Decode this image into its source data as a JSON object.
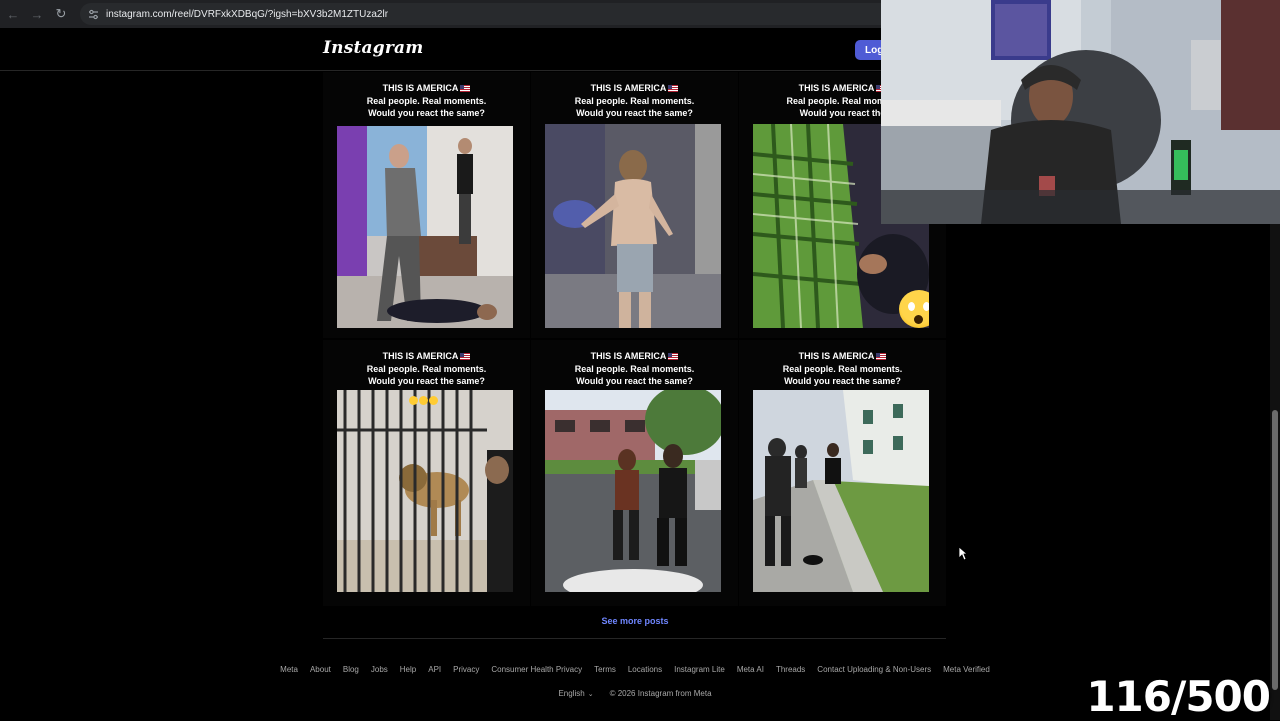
{
  "browser": {
    "url": "instagram.com/reel/DVRFxkXDBqG/?igsh=bXV3b2M1ZTUza2lr"
  },
  "header": {
    "logo_text": "Instagram",
    "login_label": "Log"
  },
  "posts": [
    {
      "line1": "THIS IS AMERICA",
      "line2": "Real people. Real moments.",
      "line3": "Would you react the same?"
    },
    {
      "line1": "THIS IS AMERICA",
      "line2": "Real people. Real moments.",
      "line3": "Would you react the same?"
    },
    {
      "line1": "THIS IS AMERICA",
      "line2": "Real people. Real moment",
      "line3": "Would you react the"
    },
    {
      "line1": "THIS IS AMERICA",
      "line2": "Real people. Real moments.",
      "line3": "Would you react the same?"
    },
    {
      "line1": "THIS IS AMERICA",
      "line2": "Real people. Real moments.",
      "line3": "Would you react the same?"
    },
    {
      "line1": "THIS IS AMERICA",
      "line2": "Real people. Real moments.",
      "line3": "Would you react the same?"
    }
  ],
  "see_more_label": "See more posts",
  "footer": {
    "links": [
      "Meta",
      "About",
      "Blog",
      "Jobs",
      "Help",
      "API",
      "Privacy",
      "Consumer Health Privacy",
      "Terms",
      "Locations",
      "Instagram Lite",
      "Meta AI",
      "Threads",
      "Contact Uploading & Non-Users",
      "Meta Verified"
    ],
    "language": "English",
    "copyright": "© 2026 Instagram from Meta"
  },
  "overlay": {
    "counter": "116/500"
  },
  "colors": {
    "background": "#000000",
    "link_blue": "#6f86ff",
    "login_button": "#4f5bd5"
  }
}
